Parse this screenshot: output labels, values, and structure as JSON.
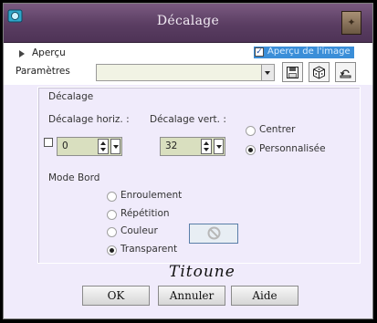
{
  "window": {
    "title": "Décalage",
    "icons": {
      "app": "paintshop-app-icon",
      "close": "close-icon"
    },
    "colors": {
      "titlebar": "#5a3d62",
      "background": "#f0ebfb",
      "accent": "#3a8ed8"
    }
  },
  "topbar": {
    "apercu_label": "Aperçu",
    "apercu_image_label": "Aperçu de l'image",
    "apercu_image_checked": true,
    "params_label": "Paramètres",
    "preset_value": "",
    "tools": [
      "save-preset-icon",
      "random-dice-icon",
      "reset-icon"
    ]
  },
  "group": {
    "title": "Décalage",
    "horiz_label": "Décalage horiz. :",
    "vert_label": "Décalage vert. :",
    "horiz_value": "0",
    "vert_value": "32",
    "link_checked": false,
    "position_options": [
      {
        "label": "Centrer",
        "selected": false
      },
      {
        "label": "Personnalisée",
        "selected": true
      }
    ],
    "edge_mode_title": "Mode Bord",
    "edge_options": [
      {
        "label": "Enroulement",
        "selected": false
      },
      {
        "label": "Répétition",
        "selected": false
      },
      {
        "label": "Couleur",
        "selected": false
      },
      {
        "label": "Transparent",
        "selected": true
      }
    ],
    "color_swatch": "#e8eef4"
  },
  "signature": "Titoune",
  "buttons": {
    "ok": "OK",
    "cancel": "Annuler",
    "help": "Aide"
  }
}
